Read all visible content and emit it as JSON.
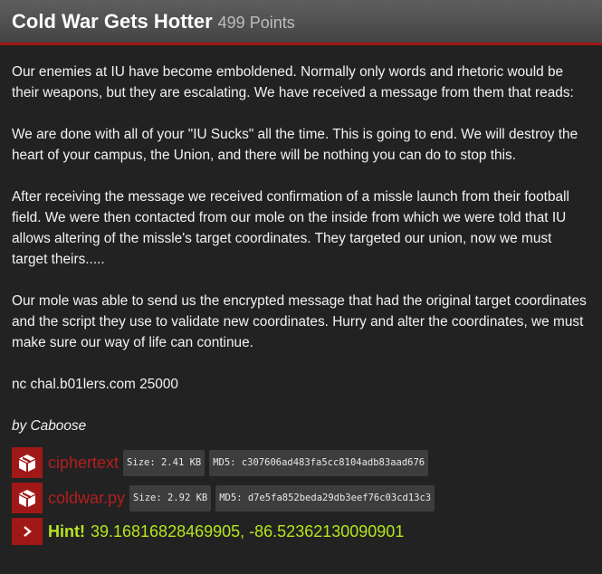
{
  "challenge": {
    "title": "Cold War Gets Hotter",
    "points": "499 Points"
  },
  "description": {
    "p1": "Our enemies at IU have become emboldened. Normally only words and rhetoric would be their weapons, but they are escalating. We have received a message from them that reads:",
    "p2": "We are done with all of your \"IU Sucks\" all the time. This is going to end. We will destroy the heart of your campus, the Union, and there will be nothing you can do to stop this.",
    "p3": "After receiving the message we received confirmation of a missle launch from their football field. We were then contacted from our mole on the inside from which we were told that IU allows altering of the missle's target coordinates. They targeted our union, now we must target theirs.....",
    "p4": "Our mole was able to send us the encrypted message that had the original target coordinates and the script they use to validate new coordinates. Hurry and alter the coordinates, we must make sure our way of life can continue.",
    "connection": "nc chal.b01lers.com 25000",
    "author": "by Caboose"
  },
  "files": [
    {
      "name": "ciphertext",
      "size": "Size: 2.41 KB",
      "md5": "MD5: c307606ad483fa5cc8104adb83aad676",
      "icon": "package-icon"
    },
    {
      "name": "coldwar.py",
      "size": "Size: 2.92 KB",
      "md5": "MD5: d7e5fa852beda29db3eef76c03cd13c3",
      "icon": "package-icon"
    }
  ],
  "hint": {
    "label": "Hint!",
    "value": "39.16816828469905, -86.52362130090901",
    "icon": "chevron-right-icon"
  },
  "colors": {
    "accent": "#a01818",
    "hint": "#b5e61d",
    "background": "#222222"
  }
}
